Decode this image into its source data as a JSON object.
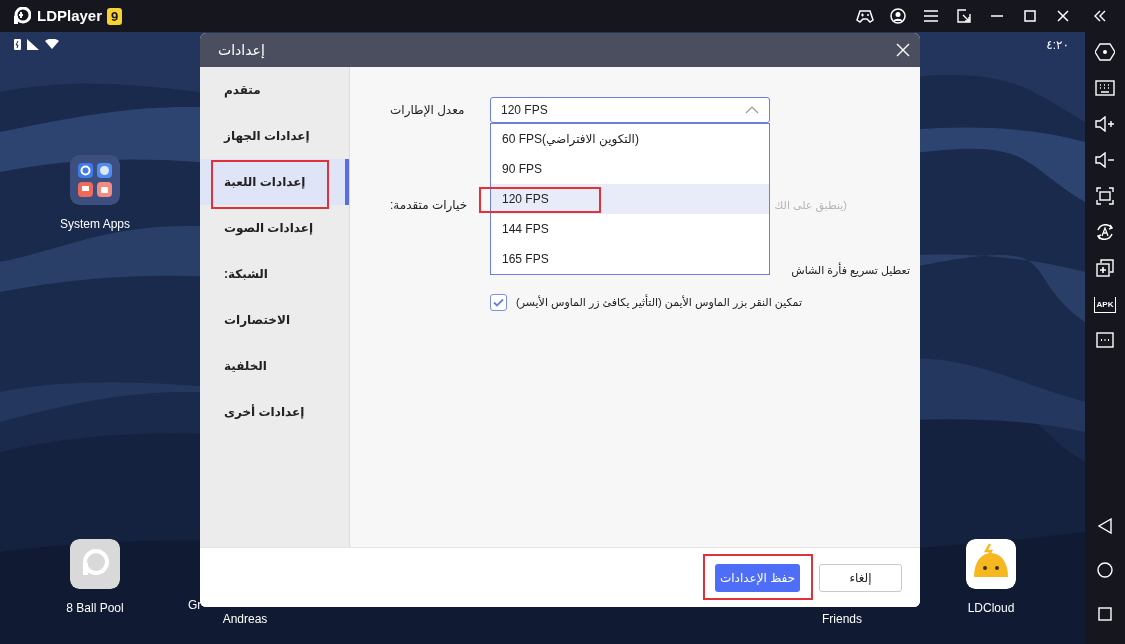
{
  "title_bar": {
    "app_name": "LDPlayer",
    "version_badge": "9"
  },
  "status_bar": {
    "time": "٤:٢٠"
  },
  "desktop_apps": [
    {
      "label": "System Apps",
      "kind": "folder"
    },
    {
      "label": "8 Ball Pool",
      "kind": "blank"
    },
    {
      "label": "LDCloud",
      "kind": "cloud"
    }
  ],
  "partial_labels": [
    "Gr",
    "Andreas",
    "Friends"
  ],
  "side_toolbar": {
    "apk_label": "APK"
  },
  "dialog": {
    "title": "إعدادات",
    "nav": [
      {
        "label": "متقدم",
        "selected": false,
        "highlighted": false
      },
      {
        "label": "إعدادات الجهاز",
        "selected": false,
        "highlighted": false
      },
      {
        "label": "إعدادات اللعبة",
        "selected": true,
        "highlighted": true
      },
      {
        "label": "إعدادات الصوت",
        "selected": false,
        "highlighted": false
      },
      {
        "label": "الشبكة:",
        "selected": false,
        "highlighted": false
      },
      {
        "label": "الاختصارات",
        "selected": false,
        "highlighted": false
      },
      {
        "label": "الخلفية",
        "selected": false,
        "highlighted": false
      },
      {
        "label": "إعدادات أخرى",
        "selected": false,
        "highlighted": false
      }
    ],
    "frame_rate": {
      "label": "معدل الإطارات",
      "value": "120 FPS",
      "expanded": true,
      "options": [
        {
          "label": "60  FPS(التكوين الافتراضي)",
          "selected": false,
          "highlighted": false
        },
        {
          "label": "90 FPS",
          "selected": false,
          "highlighted": false
        },
        {
          "label": "120 FPS",
          "selected": true,
          "highlighted": true
        },
        {
          "label": "144 FPS",
          "selected": false,
          "highlighted": false
        },
        {
          "label": "165 FPS",
          "selected": false,
          "highlighted": false
        }
      ]
    },
    "advanced": {
      "label": "خيارات متقدمة:",
      "options": [
        {
          "kind": "note",
          "label": "(ينطبق على الك",
          "disabled": true
        },
        {
          "kind": "text",
          "label": "تعطيل تسريع فأرة الشاش"
        },
        {
          "kind": "checkbox",
          "label": "تمكين النقر بزر الماوس الأيمن (التأثير يكافئ زر الماوس الأيسر)",
          "checked": true
        }
      ]
    },
    "buttons": [
      {
        "label": "إلغاء",
        "kind": "secondary",
        "highlighted": false
      },
      {
        "label": "حفظ الإعدادات",
        "kind": "primary",
        "highlighted": true
      }
    ]
  }
}
